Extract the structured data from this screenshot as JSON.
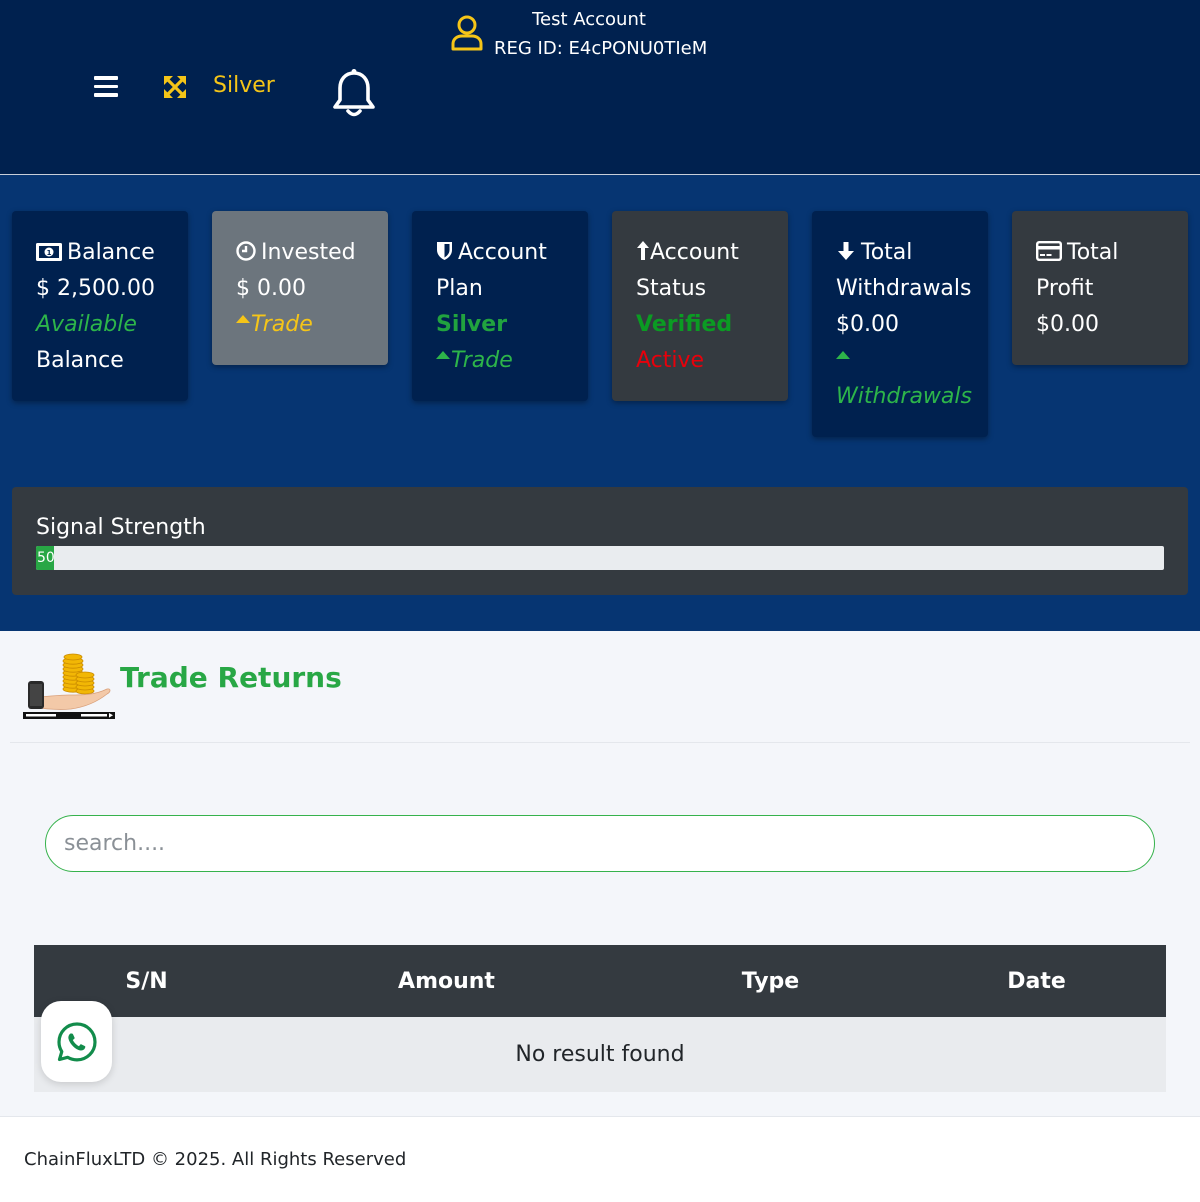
{
  "header": {
    "plan_label": "Silver",
    "account_name": "Test Account",
    "reg_id": "REG ID: E4cPONU0TIeM"
  },
  "cards": {
    "balance": {
      "title": "Balance",
      "amount": "$ 2,500.00",
      "sub1": "Available",
      "sub2": "Balance"
    },
    "invested": {
      "title": "Invested",
      "amount": "$ 0.00",
      "link": "Trade"
    },
    "plan": {
      "title1": "Account",
      "title2": "Plan",
      "value": "Silver",
      "link": "Trade"
    },
    "status": {
      "title1": "Account",
      "title2": "Status",
      "value": "Verified",
      "state": "Active"
    },
    "withdrawals": {
      "title1": "Total",
      "title2": "Withdrawals",
      "amount": "$0.00",
      "link": "Withdrawals"
    },
    "profit": {
      "title1": "Total",
      "title2": "Profit",
      "amount": "$0.00"
    }
  },
  "signal": {
    "title": "Signal Strength",
    "value": 50,
    "value_label": "50",
    "max": 3125
  },
  "trade_returns": {
    "title": "Trade Returns",
    "search_placeholder": "search....",
    "columns": [
      "S/N",
      "Amount",
      "Type",
      "Date"
    ],
    "empty_message": "No result found"
  },
  "footer": {
    "text": "ChainFluxLTD © 2025. All Rights Reserved"
  },
  "colors": {
    "header_bg": "#00214f",
    "dash_bg": "#063572",
    "accent_yellow": "#f5c518",
    "accent_green": "#28a745",
    "danger_red": "#e8000b"
  }
}
